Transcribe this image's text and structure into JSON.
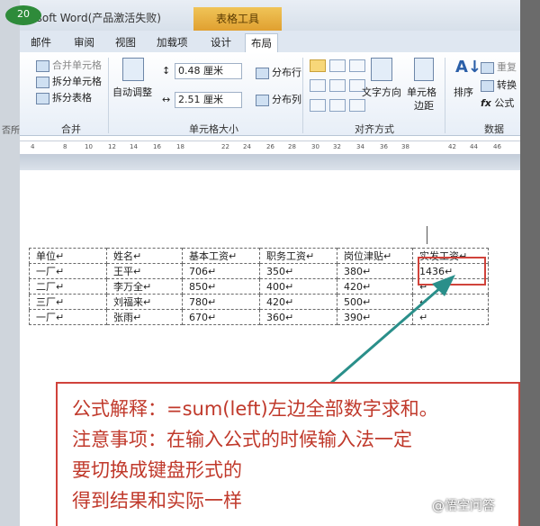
{
  "window": {
    "title": "crosoft Word(产品激活失败)",
    "contextual_tab": "表格工具",
    "badge": "20"
  },
  "tabs": [
    "邮件",
    "审阅",
    "视图",
    "加载项",
    "设计",
    "布局"
  ],
  "active_tab": "布局",
  "ribbon": {
    "merge": {
      "merge_cells": "合并单元格",
      "split_cells": "拆分单元格",
      "split_table": "拆分表格",
      "label": "合并"
    },
    "cell_size": {
      "autofit": "自动调整",
      "height": "0.48 厘米",
      "width": "2.51 厘米",
      "distribute_rows": "分布行",
      "distribute_cols": "分布列",
      "label": "单元格大小"
    },
    "alignment": {
      "text_direction": "文字方向",
      "cell_margins_1": "单元格",
      "cell_margins_2": "边距",
      "label": "对齐方式"
    },
    "data": {
      "sort": "排序",
      "repeat_header": "重复",
      "convert": "转换",
      "formula": "公式",
      "fx": "fx",
      "label": "数据"
    },
    "left_edge_label": "否所"
  },
  "ruler": {
    "ticks": [
      "4",
      "8",
      "10",
      "12",
      "14",
      "16",
      "18",
      "22",
      "24",
      "26",
      "28",
      "30",
      "32",
      "34",
      "36",
      "38",
      "42",
      "44",
      "46"
    ]
  },
  "table": {
    "headers": [
      "单位",
      "姓名",
      "基本工资",
      "职务工资",
      "岗位津贴",
      "实发工资"
    ],
    "rows": [
      [
        "一厂",
        "王平",
        "706",
        "350",
        "380",
        "1436"
      ],
      [
        "二厂",
        "李万全",
        "850",
        "400",
        "420",
        ""
      ],
      [
        "三厂",
        "刘福来",
        "780",
        "420",
        "500",
        ""
      ],
      [
        "一厂",
        "张雨",
        "670",
        "360",
        "390",
        ""
      ]
    ],
    "cell_mark": "↵"
  },
  "note": {
    "line1": "公式解释：=sum(left)左边全部数字求和。",
    "line2": "注意事项：在输入公式的时候输入法一定",
    "line3": "要切换成键盘形式的",
    "line4": "得到结果和实际一样"
  },
  "watermark": "@悟空问答",
  "colors": {
    "annotation_red": "#d0433b",
    "arrow_teal": "#2a8f8a",
    "context_tab_orange": "#e8b040"
  }
}
